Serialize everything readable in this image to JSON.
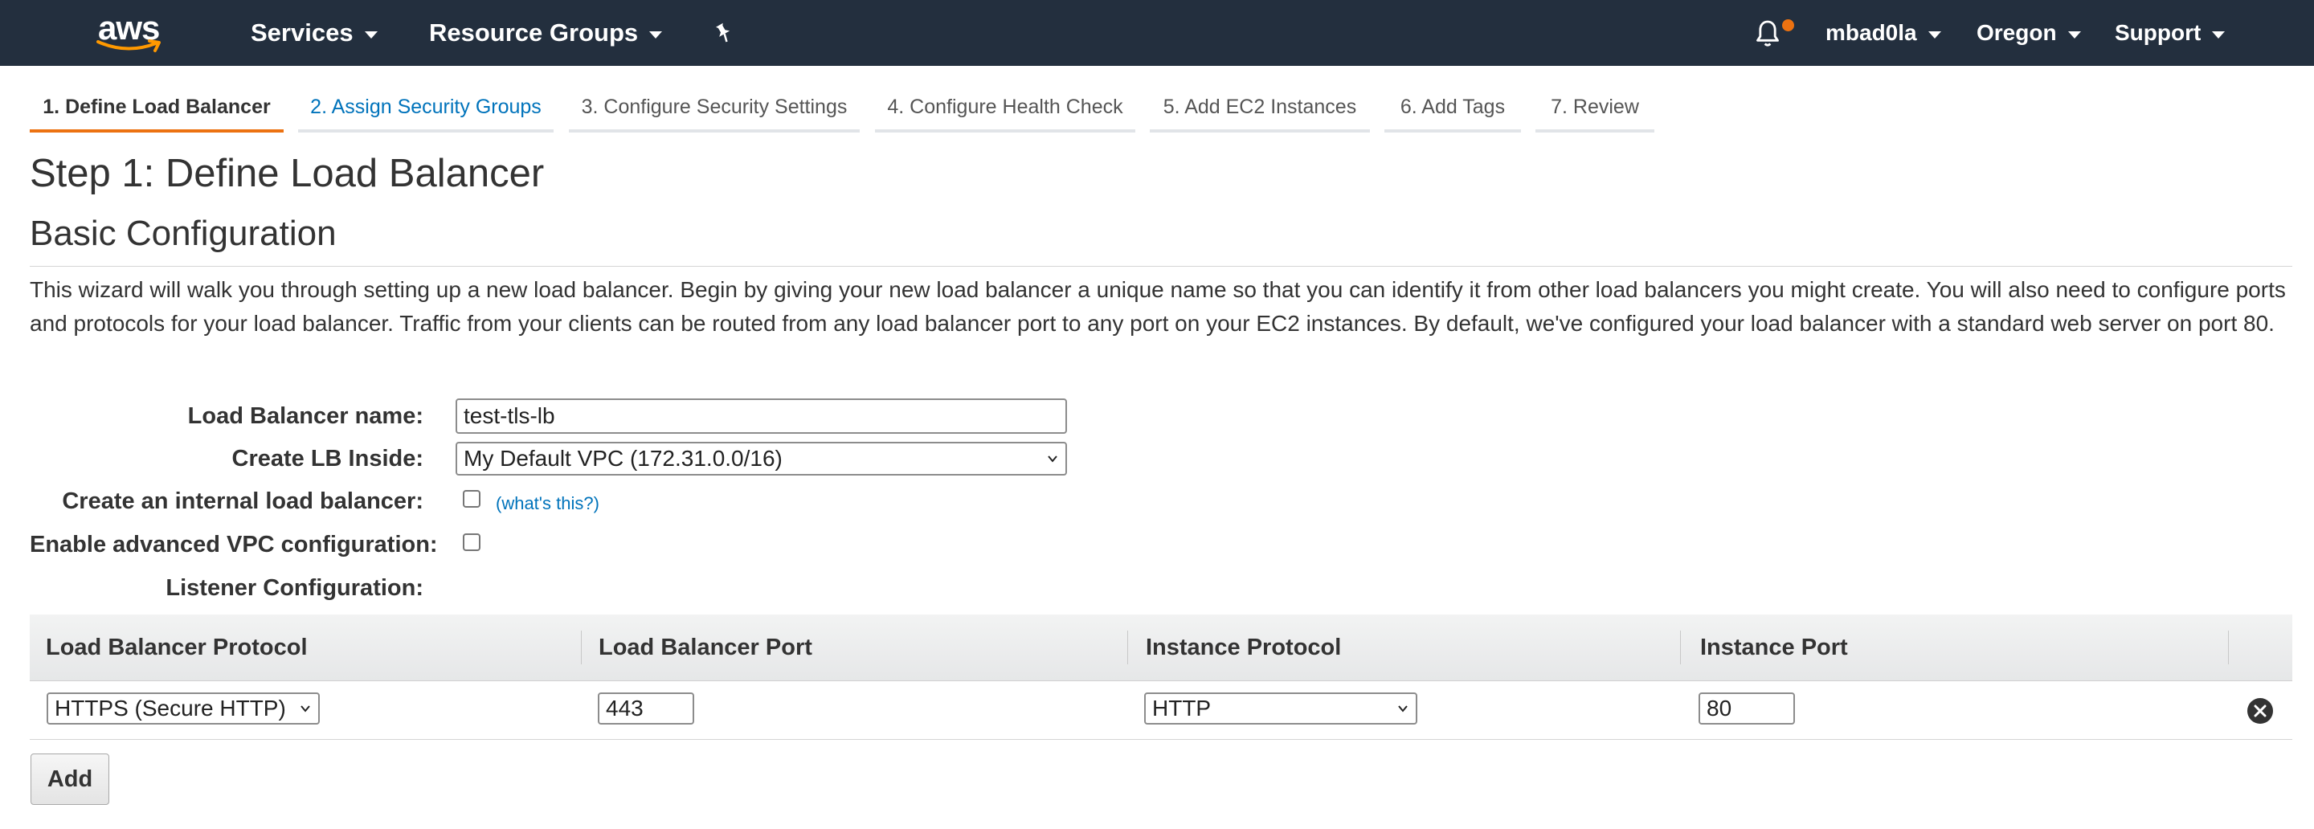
{
  "header": {
    "logo_text": "aws",
    "services": "Services",
    "resource_groups": "Resource Groups",
    "user": "mbad0la",
    "region": "Oregon",
    "support": "Support"
  },
  "wizard_tabs": [
    {
      "label": "1. Define Load Balancer",
      "state": "active"
    },
    {
      "label": "2. Assign Security Groups",
      "state": "link"
    },
    {
      "label": "3. Configure Security Settings",
      "state": "disabled"
    },
    {
      "label": "4. Configure Health Check",
      "state": "disabled"
    },
    {
      "label": "5. Add EC2 Instances",
      "state": "disabled"
    },
    {
      "label": "6. Add Tags",
      "state": "disabled"
    },
    {
      "label": "7. Review",
      "state": "disabled"
    }
  ],
  "page": {
    "title": "Step 1: Define Load Balancer",
    "section_title": "Basic Configuration",
    "intro": "This wizard will walk you through setting up a new load balancer. Begin by giving your new load balancer a unique name so that you can identify it from other load balancers you might create. You will also need to configure ports and protocols for your load balancer. Traffic from your clients can be routed from any load balancer port to any port on your EC2 instances. By default, we've configured your load balancer with a standard web server on port 80."
  },
  "form": {
    "name_label": "Load Balancer name:",
    "name_value": "test-tls-lb",
    "inside_label": "Create LB Inside:",
    "inside_value": "My Default VPC (172.31.0.0/16)",
    "internal_label": "Create an internal load balancer:",
    "internal_checked": false,
    "whats_this": "(what's this?)",
    "advanced_label": "Enable advanced VPC configuration:",
    "advanced_checked": false,
    "listener_label": "Listener Configuration:"
  },
  "listener_table": {
    "headers": [
      "Load Balancer Protocol",
      "Load Balancer Port",
      "Instance Protocol",
      "Instance Port"
    ],
    "rows": [
      {
        "lb_protocol": "HTTPS (Secure HTTP)",
        "lb_port": "443",
        "instance_protocol": "HTTP",
        "instance_port": "80"
      }
    ],
    "add_label": "Add"
  },
  "colors": {
    "nav_bg": "#232f3e",
    "accent": "#ec7211",
    "link": "#0073bb"
  }
}
